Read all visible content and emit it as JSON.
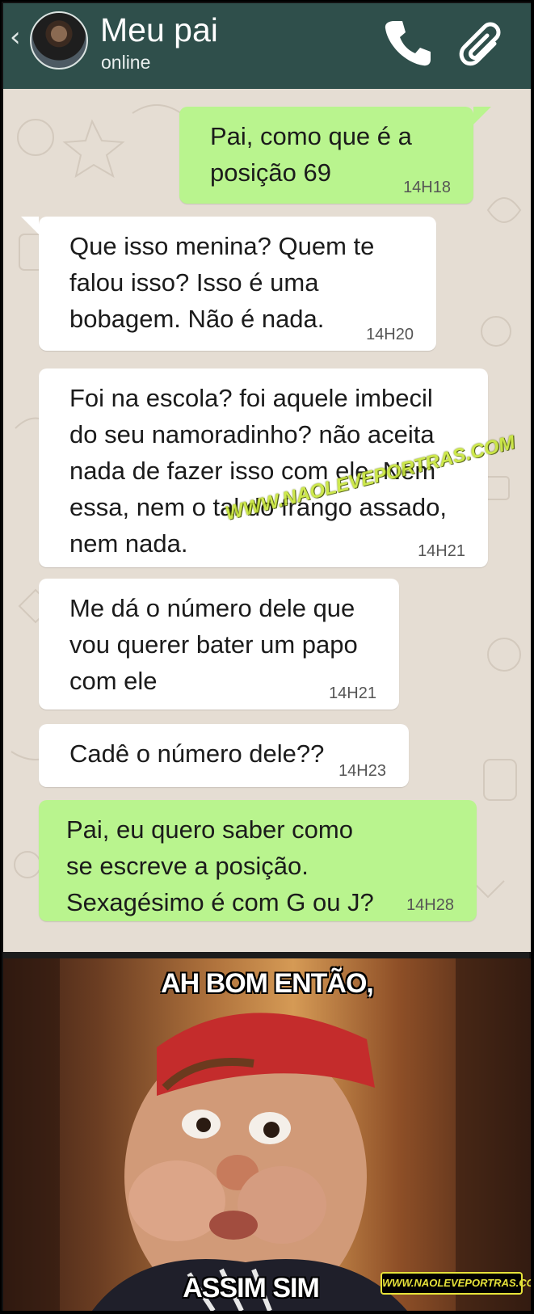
{
  "header": {
    "back_icon": "chevron-left-icon",
    "contact_name": "Meu pai",
    "status": "online",
    "call_icon": "phone-icon",
    "attach_icon": "paperclip-icon",
    "color": "#2f4f4b"
  },
  "chat": {
    "background": "#e5ddd3",
    "watermark": "WWW.NAOLEVEPORTRAS.COM",
    "messages": [
      {
        "direction": "out",
        "text": "Pai, como que é a\nposição 69",
        "time": "14H18"
      },
      {
        "direction": "in",
        "text": "Que isso menina? Quem te\nfalou isso? Isso é uma\nbobagem. Não é nada.",
        "time": "14H20"
      },
      {
        "direction": "in",
        "text": "Foi na escola? foi aquele imbecil\ndo seu namoradinho? não aceita\nnada de fazer isso com ele. Nem\nessa, nem o tal do frango assado,\nnem nada.",
        "time": "14H21"
      },
      {
        "direction": "in",
        "text": "Me dá o número dele que\nvou querer bater um papo\ncom ele",
        "time": "14H21"
      },
      {
        "direction": "in",
        "text": "Cadê o número dele??",
        "time": "14H23"
      },
      {
        "direction": "out",
        "text": "Pai, eu quero saber como\nse escreve a posição.\nSexagésimo é com G ou J?",
        "time": "14H28"
      }
    ]
  },
  "meme": {
    "caption_top": "AH BOM ENTÃO,",
    "caption_bottom": "ASSIM SIM",
    "logo": "WWW.NAOLEVEPORTRAS.COM"
  }
}
